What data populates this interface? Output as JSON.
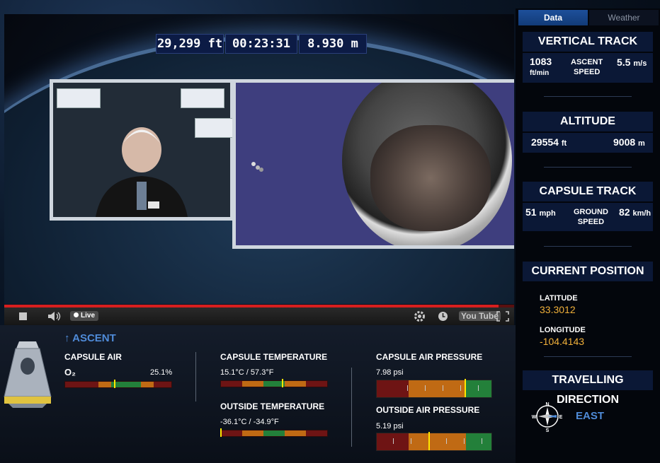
{
  "video": {
    "overlay": {
      "altitude_ft": "29,299 ft",
      "elapsed": "00:23:31",
      "altitude_m": "8.930 m"
    },
    "progress_percent": 0.97,
    "live_label": "Live",
    "brand": "You Tube"
  },
  "telemetry": {
    "section": "ASCENT",
    "capsule_air": {
      "label": "CAPSULE AIR",
      "gas": "O₂",
      "value": "25.1%",
      "gauge_fraction": 0.47
    },
    "capsule_temperature": {
      "label": "CAPSULE TEMPERATURE",
      "value": "15.1°C / 57.3°F",
      "gauge_fraction": 0.59
    },
    "outside_temperature": {
      "label": "OUTSIDE TEMPERATURE",
      "value": "-36.1°C / -34.9°F",
      "gauge_fraction": 0.0
    },
    "capsule_air_pressure": {
      "label": "CAPSULE AIR PRESSURE",
      "value": "7.98 psi",
      "gauge_fraction": 0.78
    },
    "outside_air_pressure": {
      "label": "OUTSIDE AIR PRESSURE",
      "value": "5.19 psi",
      "gauge_fraction": 0.46
    }
  },
  "sidebar": {
    "tabs": [
      "Data",
      "Weather"
    ],
    "active_tab": "Data",
    "vertical_track": {
      "title": "VERTICAL TRACK",
      "rate": "1083",
      "rate_unit": "ft/min",
      "label_line1": "ASCENT",
      "label_line2": "SPEED",
      "speed": "5.5",
      "speed_unit": "m/s"
    },
    "altitude": {
      "title": "ALTITUDE",
      "feet": "29554",
      "feet_unit": "ft",
      "meters": "9008",
      "meters_unit": "m"
    },
    "capsule_track": {
      "title": "CAPSULE TRACK",
      "mph": "51",
      "mph_unit": "mph",
      "label_line1": "GROUND",
      "label_line2": "SPEED",
      "kmh": "82",
      "kmh_unit": "km/h"
    },
    "current_position": {
      "title": "CURRENT POSITION",
      "latitude_label": "LATITUDE",
      "latitude": "33.3012",
      "longitude_label": "LONGITUDE",
      "longitude": "-104.4143"
    },
    "travelling_direction": {
      "title": "TRAVELLING DIRECTION",
      "direction": "EAST",
      "compass": {
        "n": "N",
        "e": "E",
        "s": "S",
        "w": "W"
      }
    }
  },
  "colors": {
    "accent_blue": "#4f8bd8",
    "gauge_yellow": "#ffe600",
    "value_orange": "#f0b03a",
    "progress_red": "#d71f1f"
  }
}
